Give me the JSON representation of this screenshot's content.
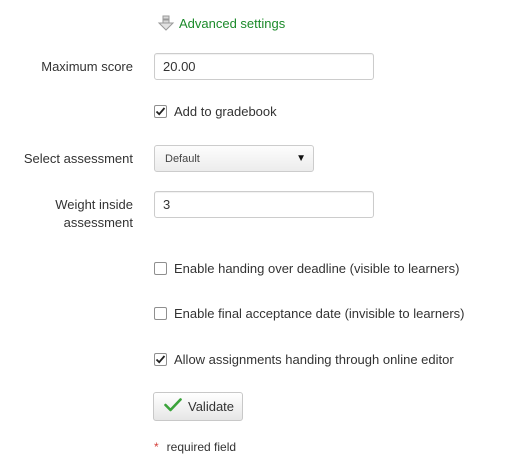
{
  "advanced_settings": {
    "label": "Advanced settings",
    "icon": "arrow-down-icon"
  },
  "form": {
    "max_score": {
      "label": "Maximum score",
      "value": "20.00"
    },
    "add_to_gradebook": {
      "label": "Add to gradebook",
      "checked": true
    },
    "select_assessment": {
      "label": "Select assessment",
      "value": "Default"
    },
    "weight": {
      "label_line1": "Weight inside",
      "label_line2": "assessment",
      "value": "3"
    },
    "handing_over_deadline": {
      "label": "Enable handing over deadline (visible to learners)",
      "checked": false
    },
    "final_acceptance": {
      "label": "Enable final acceptance date (invisible to learners)",
      "checked": false
    },
    "online_editor": {
      "label": "Allow assignments handing through online editor",
      "checked": true
    }
  },
  "validate_button": {
    "label": "Validate",
    "icon": "checkmark-icon"
  },
  "required_note": {
    "star": "*",
    "text": "required field"
  },
  "colors": {
    "link_green": "#1b8a2a",
    "check_green": "#3aa33a",
    "required_red": "#d43f3a"
  }
}
